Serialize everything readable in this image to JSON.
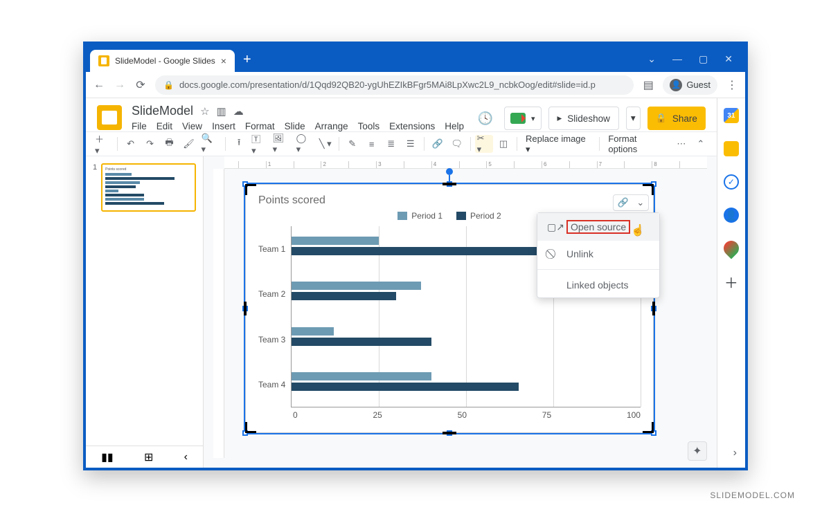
{
  "browser": {
    "tab_title": "SlideModel - Google Slides",
    "url": "docs.google.com/presentation/d/1Qqd92QB20-ygUhEZIkBFgr5MAi8LpXwc2L9_ncbkOog/edit#slide=id.p",
    "guest_label": "Guest"
  },
  "doc_header": {
    "title": "SlideModel",
    "menus": [
      "File",
      "Edit",
      "View",
      "Insert",
      "Format",
      "Slide",
      "Arrange",
      "Tools",
      "Extensions",
      "Help"
    ],
    "slideshow_label": "Slideshow",
    "share_label": "Share"
  },
  "toolbar": {
    "replace_image": "Replace image",
    "format_options": "Format options"
  },
  "ruler_marks": [
    "",
    "1",
    "",
    "2",
    "",
    "3",
    "",
    "4",
    "",
    "5",
    "",
    "6",
    "",
    "7",
    "",
    "8",
    ""
  ],
  "thumbnail": {
    "number": "1",
    "title": "Points scored"
  },
  "link_chip": {
    "link_icon": "link-icon",
    "chevron": "chevron-down-icon"
  },
  "link_menu": {
    "open_source": "Open source",
    "unlink": "Unlink",
    "linked_objects": "Linked objects"
  },
  "watermark": "SLIDEMODEL.COM",
  "chart_data": {
    "type": "bar",
    "orientation": "horizontal",
    "title": "Points scored",
    "categories": [
      "Team 1",
      "Team 2",
      "Team 3",
      "Team 4"
    ],
    "series": [
      {
        "name": "Period 1",
        "color": "#6d9bb3",
        "values": [
          25,
          37,
          12,
          40
        ]
      },
      {
        "name": "Period 2",
        "color": "#234a66",
        "values": [
          75,
          30,
          40,
          65
        ]
      }
    ],
    "x_ticks": [
      0,
      25,
      50,
      75,
      100
    ],
    "xlim": [
      0,
      100
    ],
    "xlabel": "",
    "ylabel": ""
  }
}
